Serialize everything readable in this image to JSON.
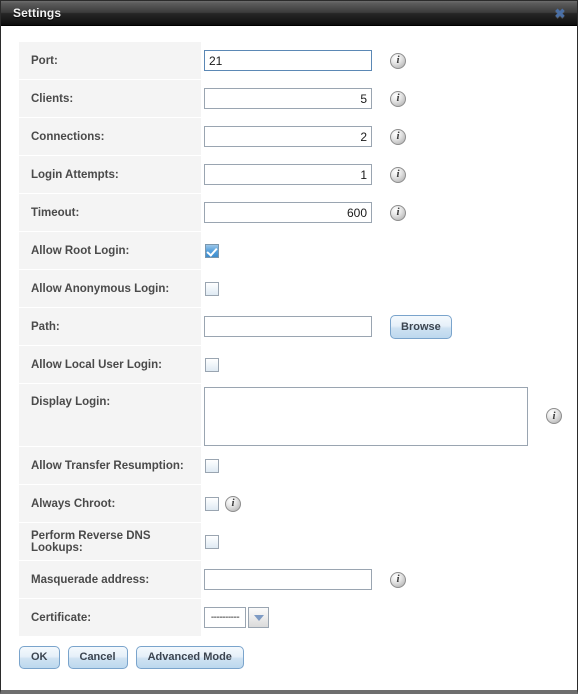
{
  "window": {
    "title": "Settings",
    "close_label": "✖",
    "close_icon": "close-icon"
  },
  "info_icon": {
    "glyph": "i",
    "name": "info-icon"
  },
  "form": {
    "rows": [
      {
        "label": "Port:",
        "value": "21",
        "type": "text-focused",
        "info": true
      },
      {
        "label": "Clients:",
        "value": "5",
        "type": "text",
        "info": true
      },
      {
        "label": "Connections:",
        "value": "2",
        "type": "text",
        "info": true
      },
      {
        "label": "Login Attempts:",
        "value": "1",
        "type": "text",
        "info": true
      },
      {
        "label": "Timeout:",
        "value": "600",
        "type": "text",
        "info": true
      },
      {
        "label": "Allow Root Login:",
        "value": "",
        "type": "checkbox-checked",
        "info": false
      },
      {
        "label": "Allow Anonymous Login:",
        "value": "",
        "type": "checkbox",
        "info": false
      },
      {
        "label": "Path:",
        "value": "",
        "type": "text-browse",
        "info": false
      },
      {
        "label": "Allow Local User Login:",
        "value": "",
        "type": "checkbox",
        "info": false
      },
      {
        "label": "Display Login:",
        "value": "",
        "type": "textarea",
        "info": true
      },
      {
        "label": "Allow Transfer Resumption:",
        "value": "",
        "type": "checkbox",
        "info": false
      },
      {
        "label": "Always Chroot:",
        "value": "",
        "type": "checkbox-info",
        "info": false
      },
      {
        "label": "Perform Reverse DNS Lookups:",
        "value": "",
        "type": "checkbox",
        "info": false
      },
      {
        "label": "Masquerade address:",
        "value": "",
        "type": "text",
        "info": true
      },
      {
        "label": "Certificate:",
        "value": "----------",
        "type": "select",
        "info": false
      }
    ],
    "browse_label": "Browse",
    "certificate_selected": "----------"
  },
  "footer": {
    "ok_label": "OK",
    "cancel_label": "Cancel",
    "advanced_label": "Advanced Mode"
  }
}
